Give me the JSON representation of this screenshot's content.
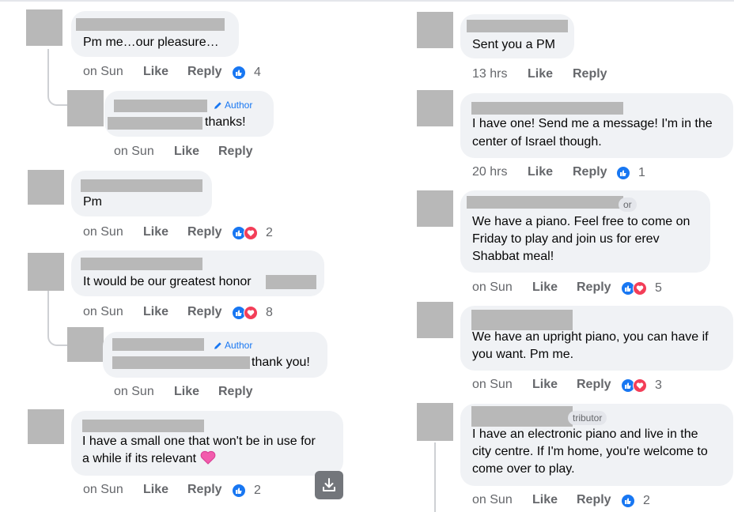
{
  "actions": {
    "like": "Like",
    "reply": "Reply"
  },
  "colors": {
    "accent": "#1877f2",
    "love": "#f33e58",
    "bubble": "#f0f2f5",
    "meta": "#65676b",
    "redaction": "#b8b8b8"
  },
  "icons": {
    "like_reaction": "thumbs-up-icon",
    "love_reaction": "heart-icon",
    "author_badge": "pencil-icon",
    "download": "download-icon",
    "emoji": "pink-heart-emoji"
  },
  "left": {
    "c1": {
      "text": "Pm me…our pleasure…",
      "time": "on Sun",
      "reactions": 4
    },
    "r1": {
      "badge": "Author",
      "text": "thanks!",
      "time": "on Sun"
    },
    "c2": {
      "text": "Pm",
      "time": "on Sun",
      "reactions": 2
    },
    "c3": {
      "text": "It would be our greatest honor",
      "time": "on Sun",
      "reactions": 8
    },
    "r3": {
      "badge": "Author",
      "text": "thank you!",
      "time": "on Sun"
    },
    "c4": {
      "text1": "I have a small one that won't be in use for",
      "text2": "a while if its relevant",
      "time": "on Sun",
      "reactions": 2
    }
  },
  "right": {
    "c1": {
      "text": "Sent you a PM",
      "time": "13 hrs"
    },
    "c2": {
      "text1": "I have one! Send me a message! I'm in the",
      "text2": "center of Israel though.",
      "time": "20 hrs",
      "reactions": 1
    },
    "c3": {
      "badge_fragment": "or",
      "text1": "We have a piano. Feel free to come on",
      "text2": "Friday to play and join us for erev",
      "text3": "Shabbat meal!",
      "time": "on Sun",
      "reactions": 5
    },
    "c4": {
      "text1": "We have an upright piano, you can have if",
      "text2": "you want. Pm me.",
      "time": "on Sun",
      "reactions": 3
    },
    "c5": {
      "badge_fragment": "tributor",
      "text1": "I have an electronic piano and live in the",
      "text2": "city centre. If I'm home, you're welcome to",
      "text3": "come over to play.",
      "time": "on Sun",
      "reactions": 2
    }
  }
}
